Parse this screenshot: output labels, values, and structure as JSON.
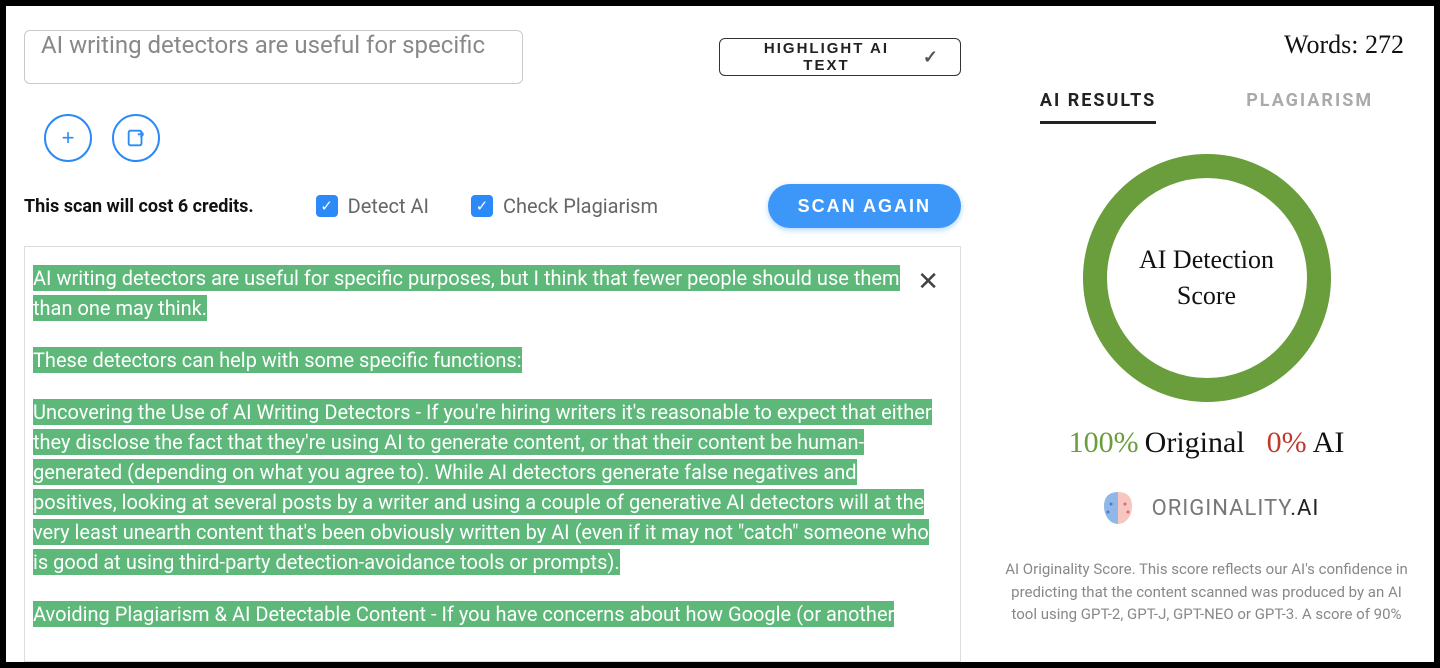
{
  "header": {
    "title_input_value": "AI writing detectors are useful for specific",
    "highlight_btn": "HIGHLIGHT AI TEXT",
    "words_label": "Words:",
    "words_count": "272"
  },
  "controls": {
    "cost_text": "This scan will cost 6 credits.",
    "detect_ai_label": "Detect AI",
    "check_plag_label": "Check Plagiarism",
    "scan_again_label": "SCAN AGAIN"
  },
  "editor": {
    "p1": "AI writing detectors are useful for specific purposes, but I think that fewer people should use them than one may think.",
    "p2": "These detectors can help with some specific functions:",
    "p3": "Uncovering the Use of AI Writing Detectors - If you're hiring writers it's reasonable to expect that either they disclose the fact that they're using AI to generate content, or that their content be human-generated (depending on what you agree to). While AI detectors generate false negatives and positives, looking at several posts by a writer and using a couple of generative AI detectors will at the very least unearth content that's been obviously written by AI (even if it may not \"catch\" someone who is good at using third-party detection-avoidance tools or prompts).",
    "p4": "Avoiding Plagiarism & AI Detectable Content - If you have concerns about how Google (or another"
  },
  "results": {
    "tab_ai": "AI RESULTS",
    "tab_plag": "PLAGIARISM",
    "score_title_l1": "AI Detection",
    "score_title_l2": "Score",
    "original_pct": "100%",
    "original_lbl": "Original",
    "ai_pct": "0%",
    "ai_lbl": "AI",
    "brand_name": "ORIGINALITY",
    "brand_suffix": ".AI",
    "desc": "AI Originality Score. This score reflects our AI's confidence in predicting that the content scanned was produced by an AI tool using GPT-2, GPT-J, GPT-NEO or GPT-3. A score of 90%"
  }
}
